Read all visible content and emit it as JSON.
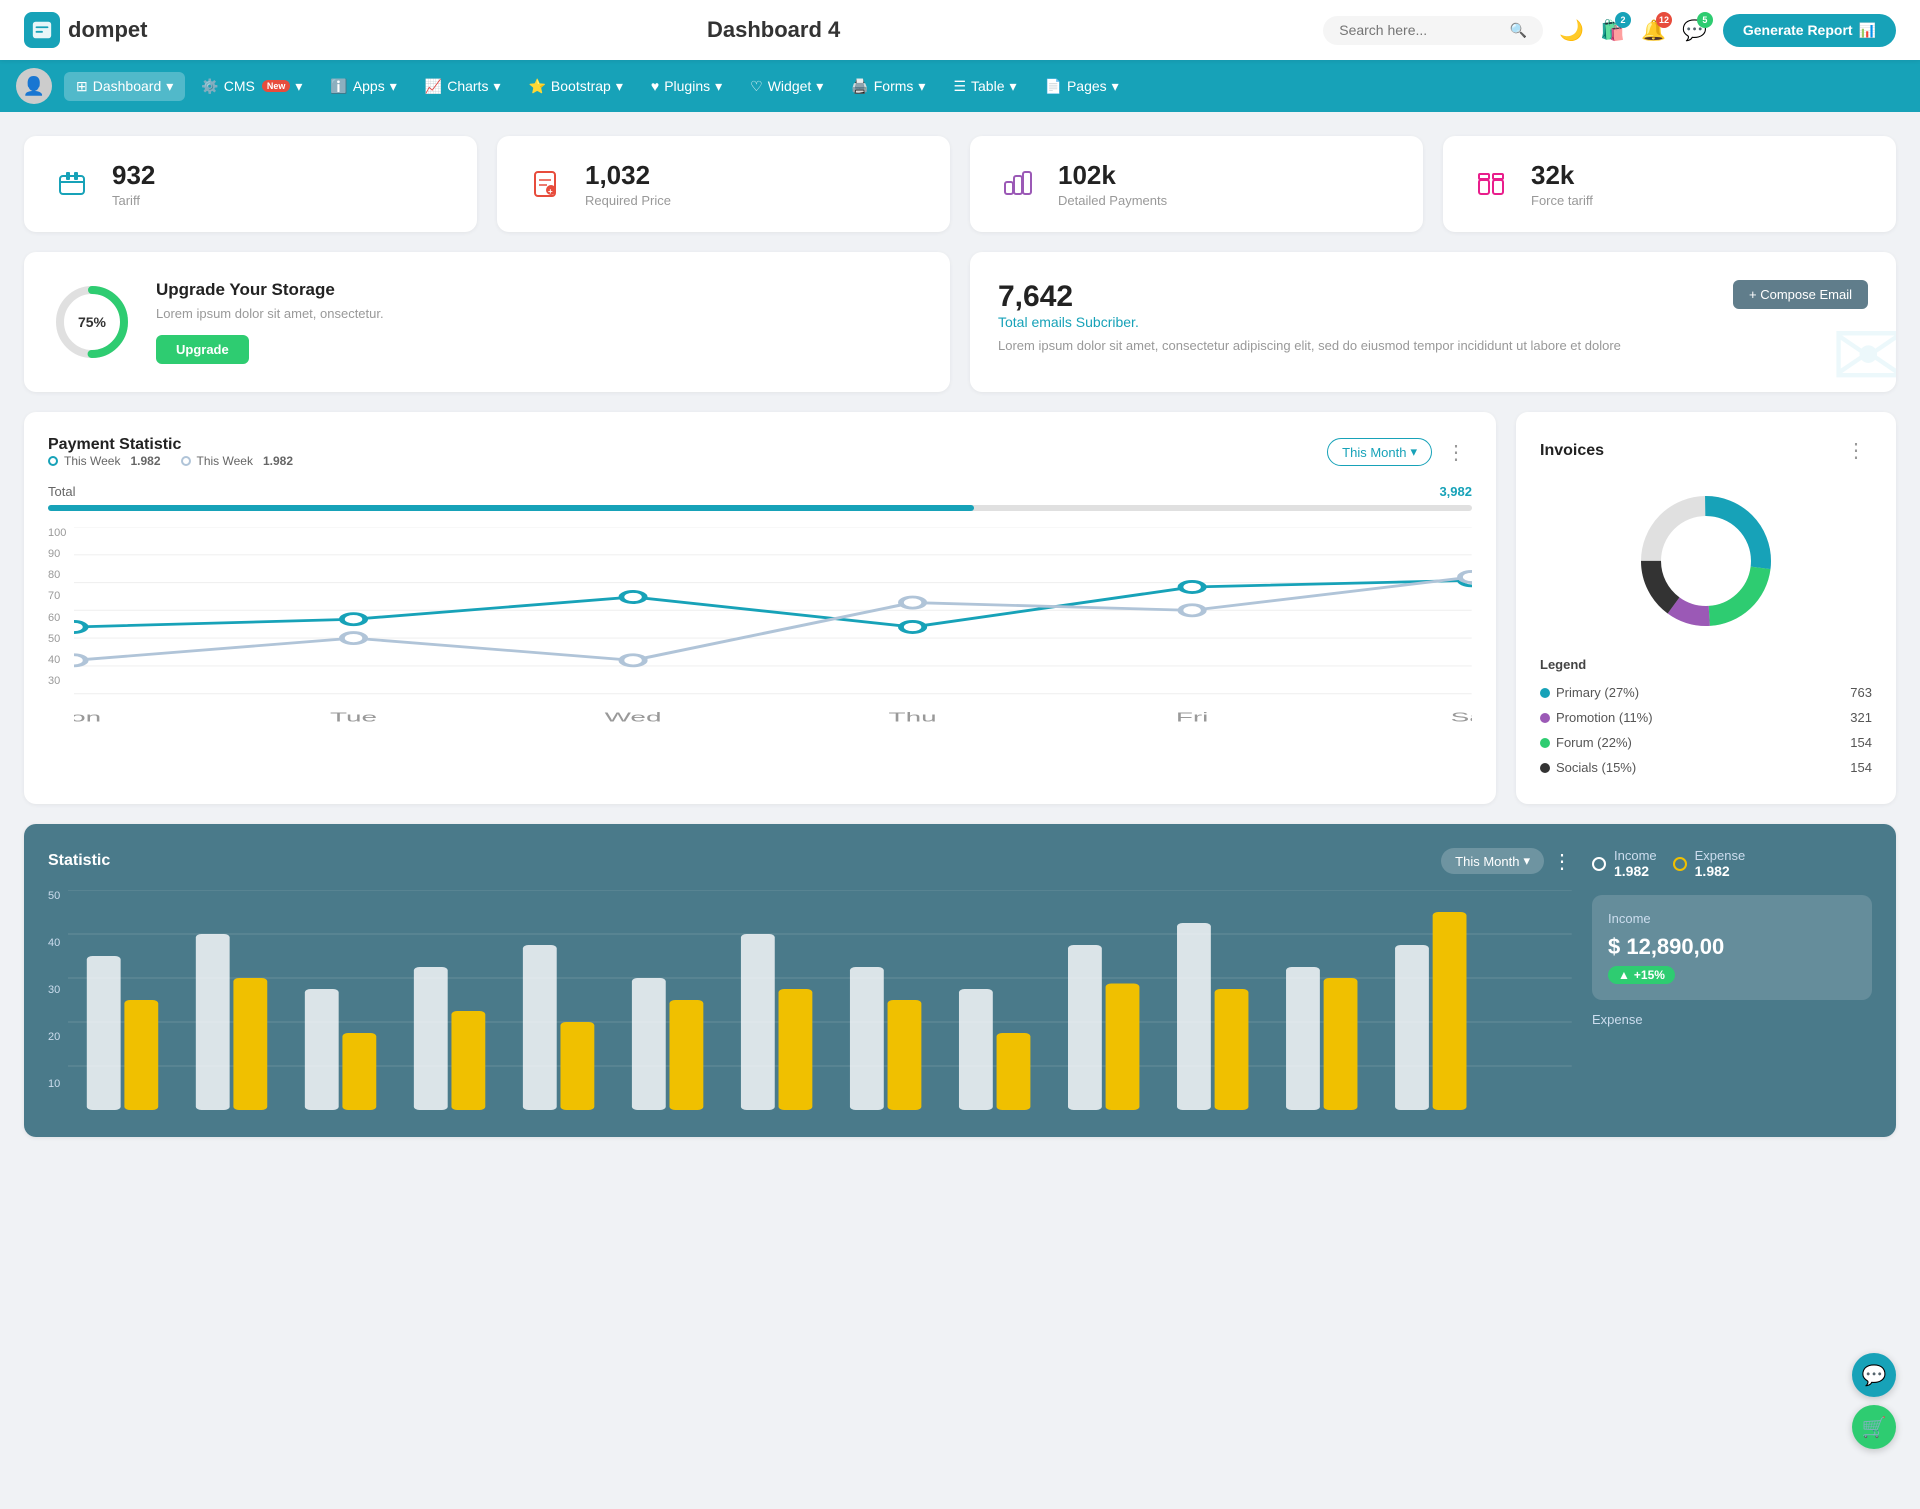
{
  "header": {
    "logo_text": "dompet",
    "title": "Dashboard 4",
    "search_placeholder": "Search here...",
    "generate_btn": "Generate Report",
    "badges": {
      "shop": "2",
      "bell": "12",
      "chat": "5"
    }
  },
  "navbar": {
    "items": [
      {
        "id": "dashboard",
        "label": "Dashboard",
        "active": true,
        "has_arrow": true
      },
      {
        "id": "cms",
        "label": "CMS",
        "active": false,
        "has_arrow": true,
        "badge_new": "New"
      },
      {
        "id": "apps",
        "label": "Apps",
        "active": false,
        "has_arrow": true
      },
      {
        "id": "charts",
        "label": "Charts",
        "active": false,
        "has_arrow": true
      },
      {
        "id": "bootstrap",
        "label": "Bootstrap",
        "active": false,
        "has_arrow": true
      },
      {
        "id": "plugins",
        "label": "Plugins",
        "active": false,
        "has_arrow": true
      },
      {
        "id": "widget",
        "label": "Widget",
        "active": false,
        "has_arrow": true
      },
      {
        "id": "forms",
        "label": "Forms",
        "active": false,
        "has_arrow": true
      },
      {
        "id": "table",
        "label": "Table",
        "active": false,
        "has_arrow": true
      },
      {
        "id": "pages",
        "label": "Pages",
        "active": false,
        "has_arrow": true
      }
    ]
  },
  "stat_cards": [
    {
      "id": "tariff",
      "value": "932",
      "label": "Tariff",
      "color": "#17a2b8"
    },
    {
      "id": "required_price",
      "value": "1,032",
      "label": "Required Price",
      "color": "#e74c3c"
    },
    {
      "id": "detailed_payments",
      "value": "102k",
      "label": "Detailed Payments",
      "color": "#9b59b6"
    },
    {
      "id": "force_tariff",
      "value": "32k",
      "label": "Force tariff",
      "color": "#e91e8c"
    }
  ],
  "storage": {
    "percent": "75%",
    "title": "Upgrade Your Storage",
    "description": "Lorem ipsum dolor sit amet, onsectetur.",
    "btn_label": "Upgrade",
    "percent_num": 75
  },
  "email": {
    "count": "7,642",
    "subtitle": "Total emails Subcriber.",
    "description": "Lorem ipsum dolor sit amet, consectetur adipiscing elit, sed do eiusmod tempor incididunt ut labore et dolore",
    "compose_btn": "+ Compose Email"
  },
  "payment_chart": {
    "title": "Payment Statistic",
    "filter_label": "This Month",
    "more_icon": "⋮",
    "legend": [
      {
        "label": "This Week",
        "value": "1.982",
        "color": "#17a2b8"
      },
      {
        "label": "This Week",
        "value": "1.982",
        "color": "#b0c4d8"
      }
    ],
    "total_label": "Total",
    "total_value": "3,982",
    "progress_pct": 65,
    "x_labels": [
      "Mon",
      "Tue",
      "Wed",
      "Thu",
      "Fri",
      "Sat"
    ],
    "y_labels": [
      "100",
      "90",
      "80",
      "70",
      "60",
      "50",
      "40",
      "30"
    ]
  },
  "invoices": {
    "title": "Invoices",
    "more_icon": "⋮",
    "legend": [
      {
        "label": "Primary (27%)",
        "value": "763",
        "color": "#17a2b8"
      },
      {
        "label": "Promotion (11%)",
        "value": "321",
        "color": "#9b59b6"
      },
      {
        "label": "Forum (22%)",
        "value": "154",
        "color": "#2ecc71"
      },
      {
        "label": "Socials (15%)",
        "value": "154",
        "color": "#333"
      }
    ]
  },
  "statistic": {
    "title": "Statistic",
    "filter_label": "This Month",
    "more_icon": "⋮",
    "income": {
      "label": "Income",
      "legend_value": "1.982",
      "amount": "$ 12,890,00",
      "badge": "+15%"
    },
    "expense": {
      "label": "Expense",
      "legend_value": "1.982"
    },
    "y_labels": [
      "50",
      "40",
      "30",
      "20",
      "10"
    ]
  }
}
